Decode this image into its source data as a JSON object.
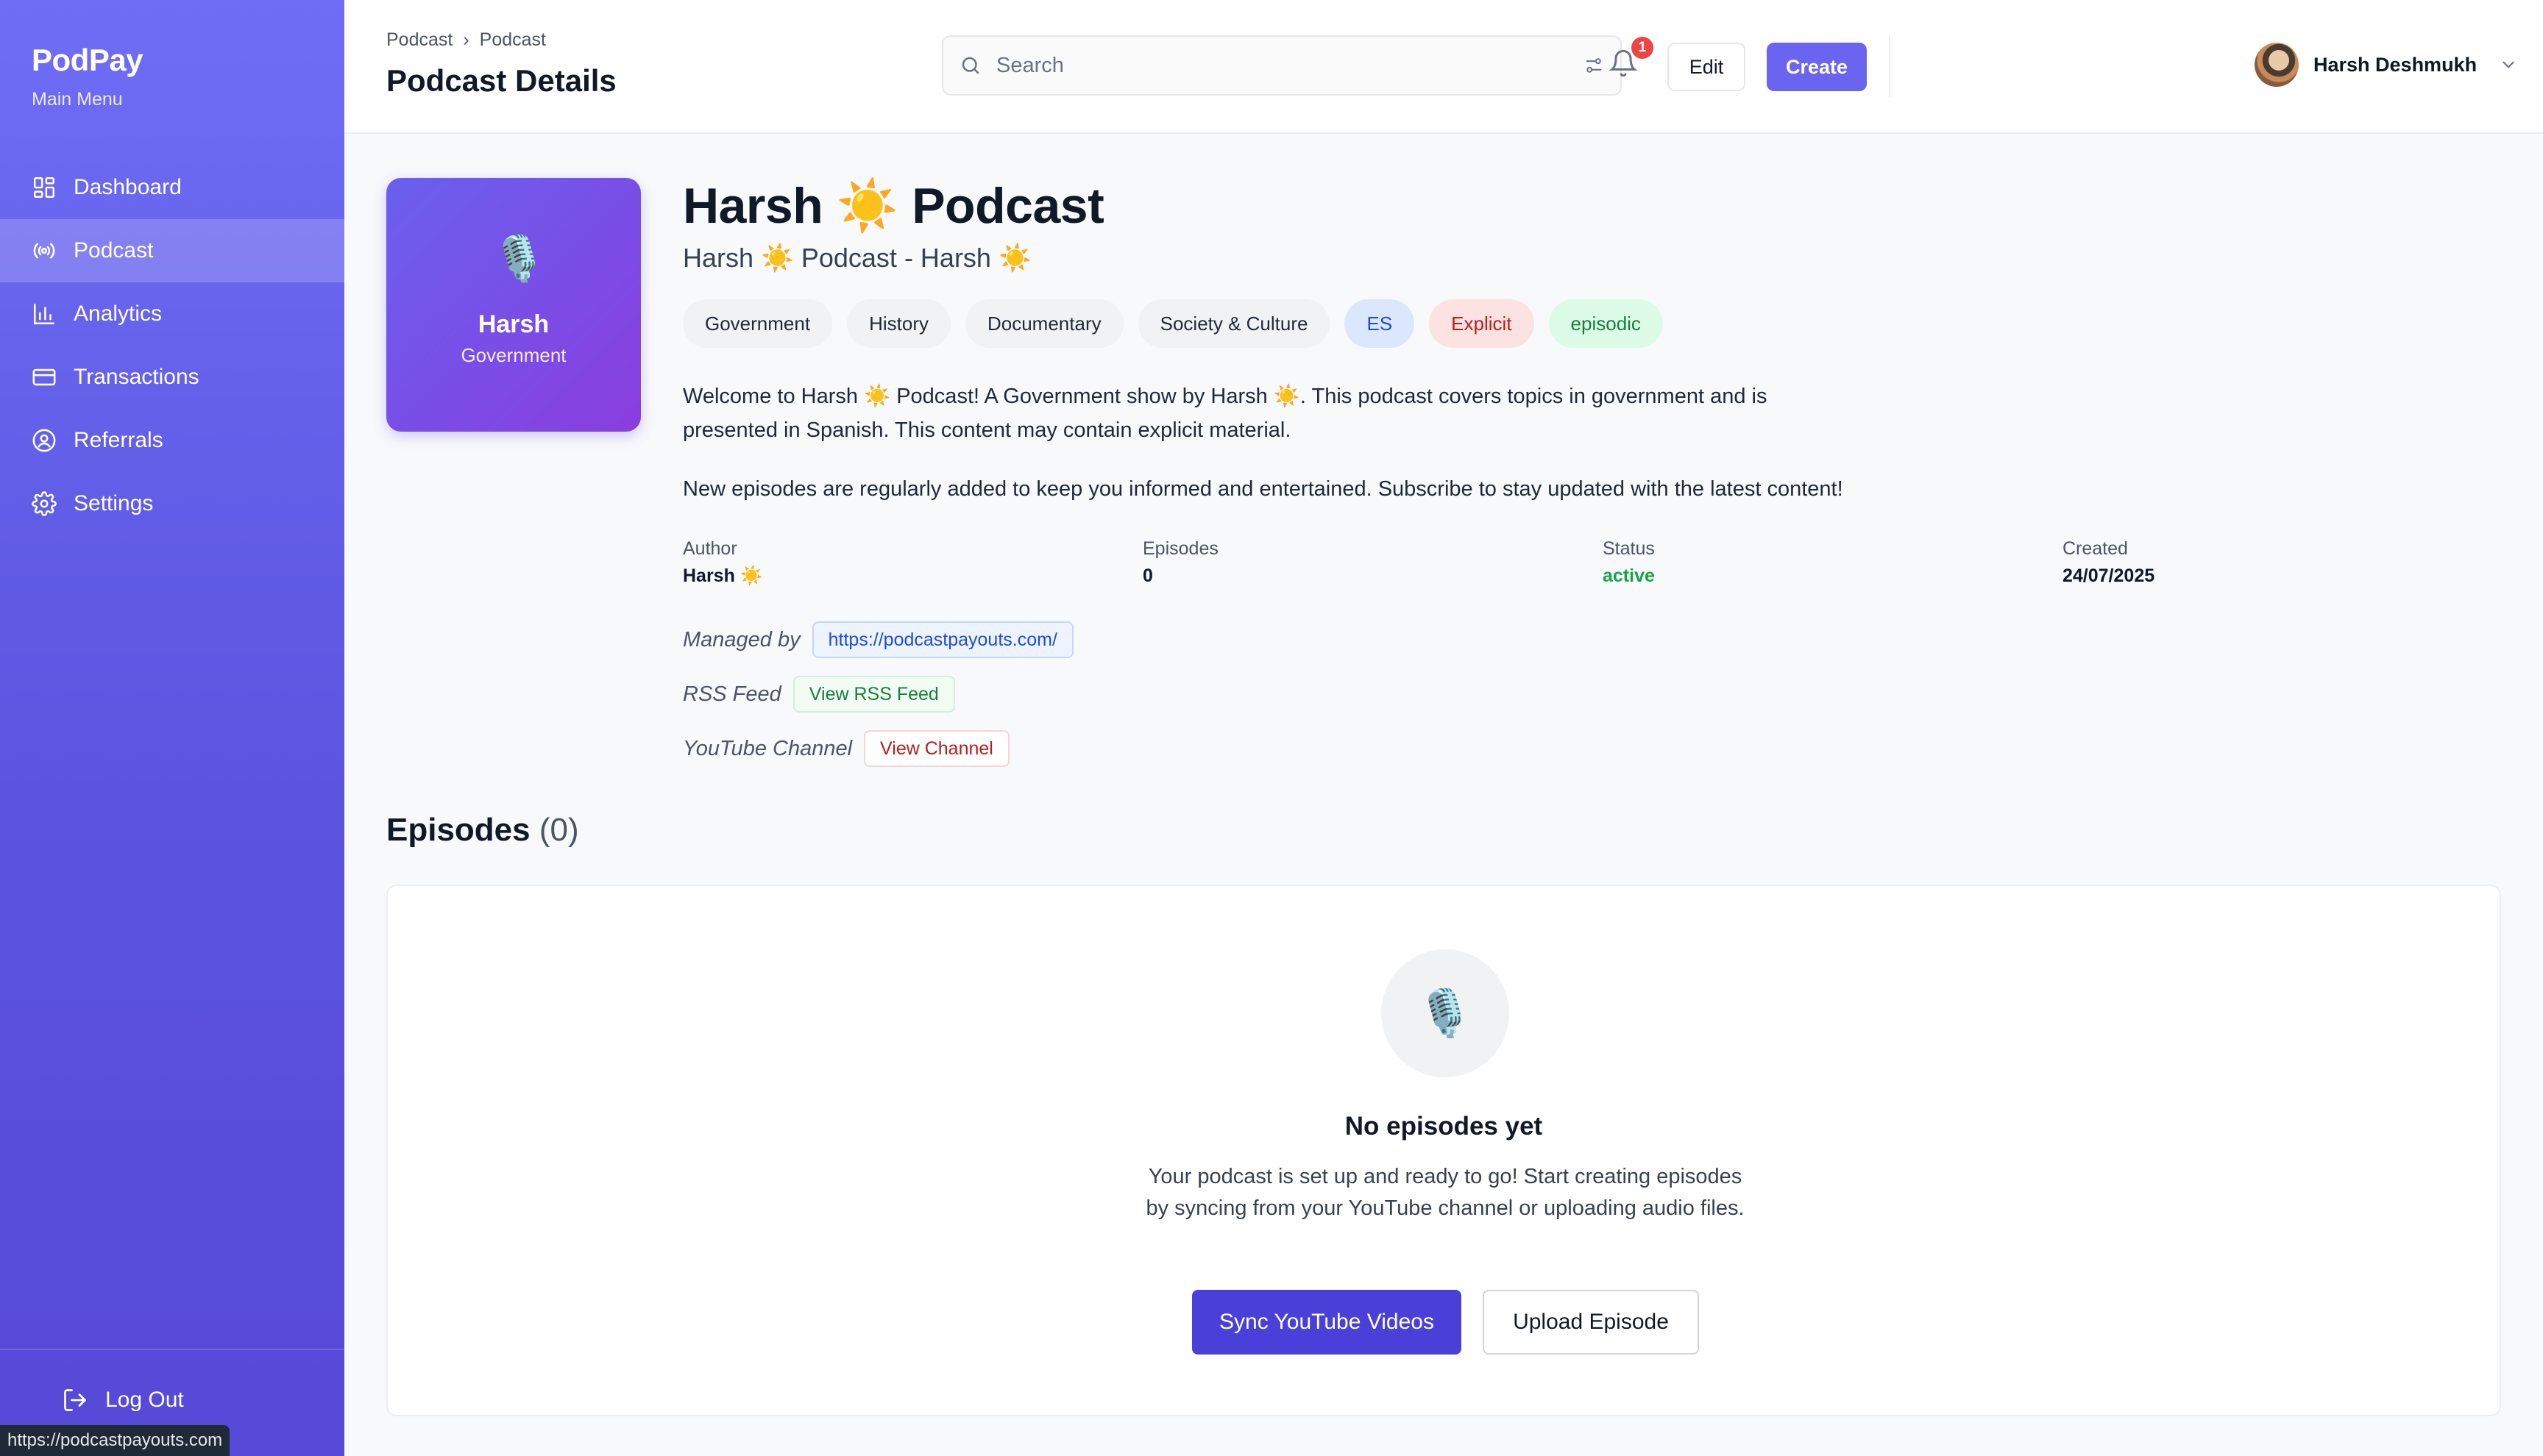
{
  "app": {
    "name": "PodPay",
    "menu_label": "Main Menu"
  },
  "sidebar": {
    "items": [
      {
        "label": "Dashboard",
        "icon": "dashboard-icon"
      },
      {
        "label": "Podcast",
        "icon": "broadcast-icon",
        "active": true
      },
      {
        "label": "Analytics",
        "icon": "bar-chart-icon"
      },
      {
        "label": "Transactions",
        "icon": "credit-card-icon"
      },
      {
        "label": "Referrals",
        "icon": "user-circle-icon"
      },
      {
        "label": "Settings",
        "icon": "gear-icon"
      }
    ],
    "logout_label": "Log Out"
  },
  "status_bar": {
    "url": "https://podcastpayouts.com"
  },
  "header": {
    "breadcrumb": [
      "Podcast",
      "Podcast"
    ],
    "breadcrumb_separator": "›",
    "title": "Podcast Details",
    "search_placeholder": "Search",
    "notification_count": "1",
    "edit_label": "Edit",
    "create_label": "Create",
    "user_name": "Harsh Deshmukh"
  },
  "podcast": {
    "cover_emoji": "🎙️",
    "cover_title": "Harsh",
    "cover_subtitle": "Government",
    "title": "Harsh ☀️ Podcast",
    "subtitle": "Harsh ☀️ Podcast - Harsh ☀️",
    "tags": [
      "Government",
      "History",
      "Documentary",
      "Society & Culture",
      "ES",
      "Explicit",
      "episodic"
    ],
    "description_1": "Welcome to Harsh ☀️ Podcast! A Government show by Harsh ☀️. This podcast covers topics in government and is presented in Spanish. This content may contain explicit material.",
    "description_2": "New episodes are regularly added to keep you informed and entertained. Subscribe to stay updated with the latest content!",
    "meta": {
      "author_label": "Author",
      "author": "Harsh ☀️",
      "episodes_label": "Episodes",
      "episodes": "0",
      "status_label": "Status",
      "status": "active",
      "created_label": "Created",
      "created": "24/07/2025"
    },
    "managed_by_label": "Managed by",
    "managed_by_link": "https://podcastpayouts.com/",
    "rss_label": "RSS Feed",
    "rss_link": "View RSS Feed",
    "youtube_label": "YouTube Channel",
    "youtube_link": "View Channel"
  },
  "episodes": {
    "heading": "Episodes",
    "count": "(0)",
    "empty_emoji": "🎙️",
    "empty_title": "No episodes yet",
    "empty_text": "Your podcast is set up and ready to go! Start creating episodes by syncing from your YouTube channel or uploading audio files.",
    "sync_label": "Sync YouTube Videos",
    "upload_label": "Upload Episode"
  },
  "colors": {
    "sidebar_top": "#6f6df5",
    "sidebar_bottom": "#5749d8",
    "accent": "#6a64f0",
    "primary_button": "#4a3fd9",
    "status_active": "#16a34a"
  }
}
